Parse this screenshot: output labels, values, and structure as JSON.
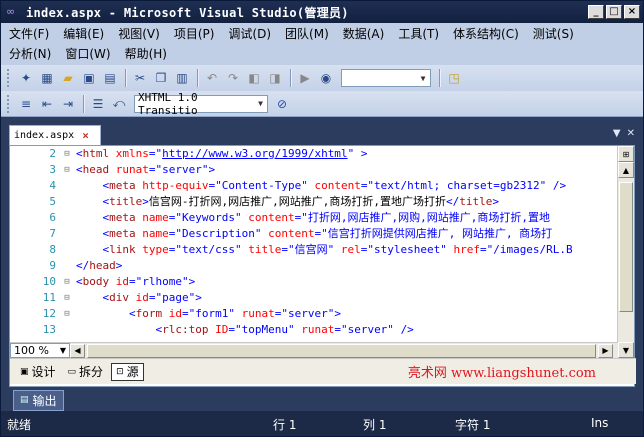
{
  "window": {
    "title": "index.aspx - Microsoft Visual Studio(管理员)",
    "min": "_",
    "max": "□",
    "close": "×"
  },
  "menu": {
    "row1": [
      "文件(F)",
      "编辑(E)",
      "视图(V)",
      "项目(P)",
      "调试(D)",
      "团队(M)",
      "数据(A)",
      "工具(T)",
      "体系结构(C)",
      "测试(S)"
    ],
    "row2": [
      "分析(N)",
      "窗口(W)",
      "帮助(H)"
    ]
  },
  "toolbar": {
    "solution_config": "",
    "doc_type": "XHTML 1.0 Transitio"
  },
  "tab": {
    "label": "index.aspx",
    "close": "×"
  },
  "code": [
    {
      "n": "2",
      "fold": "⊟",
      "html": "<span class='b'>&lt;</span><span class='t'>html</span> <span class='a'>xmlns</span><span class='b'>=\"<u>http://www.w3.org/1999/xhtml</u>\"</span> <span class='b'>&gt;</span>"
    },
    {
      "n": "3",
      "fold": "⊟",
      "html": "<span class='b'>&lt;</span><span class='t'>head</span> <span class='a'>runat</span><span class='b'>=\"server\"&gt;</span>"
    },
    {
      "n": "4",
      "fold": "",
      "html": "    <span class='b'>&lt;</span><span class='t'>meta</span> <span class='a'>http-equiv</span><span class='b'>=\"Content-Type\"</span> <span class='a'>content</span><span class='b'>=\"text/html; charset=gb2312\"</span> <span class='b'>/&gt;</span>"
    },
    {
      "n": "5",
      "fold": "",
      "html": "    <span class='b'>&lt;</span><span class='t'>title</span><span class='b'>&gt;</span>信宫网-打折网,网店推广,网站推广,商场打折,置地广场打折<span class='b'>&lt;/</span><span class='t'>title</span><span class='b'>&gt;</span>"
    },
    {
      "n": "6",
      "fold": "",
      "html": "    <span class='b'>&lt;</span><span class='t'>meta</span> <span class='a'>name</span><span class='b'>=\"Keywords\"</span> <span class='a'>content</span><span class='b'>=\"打折网,网店推广,网购,网站推广,商场打折,置地</span>"
    },
    {
      "n": "7",
      "fold": "",
      "html": "    <span class='b'>&lt;</span><span class='t'>meta</span> <span class='a'>name</span><span class='b'>=\"Description\"</span> <span class='a'>content</span><span class='b'>=\"信宫打折网提供网店推广, 网站推广, 商场打</span>"
    },
    {
      "n": "8",
      "fold": "",
      "html": "    <span class='b'>&lt;</span><span class='t'>link</span> <span class='a'>type</span><span class='b'>=\"text/css\"</span> <span class='a'>title</span><span class='b'>=\"信宫网\"</span> <span class='a'>rel</span><span class='b'>=\"stylesheet\"</span> <span class='a'>href</span><span class='b'>=\"/images/RL.B</span>"
    },
    {
      "n": "9",
      "fold": "",
      "html": "<span class='b'>&lt;/</span><span class='t'>head</span><span class='b'>&gt;</span>"
    },
    {
      "n": "10",
      "fold": "⊟",
      "html": "<span class='b'>&lt;</span><span class='t'>body</span> <span class='a'>id</span><span class='b'>=\"rlhome\"&gt;</span>"
    },
    {
      "n": "11",
      "fold": "⊟",
      "html": "    <span class='b'>&lt;</span><span class='t'>div</span> <span class='a'>id</span><span class='b'>=\"page\"&gt;</span>"
    },
    {
      "n": "12",
      "fold": "⊟",
      "html": "        <span class='b'>&lt;</span><span class='t'>form</span> <span class='a'>id</span><span class='b'>=\"form1\"</span> <span class='a'>runat</span><span class='b'>=\"server\"&gt;</span>"
    },
    {
      "n": "13",
      "fold": "",
      "html": "            <span class='b'>&lt;</span><span class='t'>rlc:top</span> <span class='a'>ID</span><span class='b'>=\"topMenu\"</span> <span class='a'>runat</span><span class='b'>=\"server\"</span> <span class='b'>/&gt;</span>"
    }
  ],
  "zoom": "100 %",
  "views": {
    "design": "设计",
    "split": "拆分",
    "source": "源"
  },
  "watermark": "亮术网 www.liangshunet.com",
  "output": "输出",
  "status": {
    "ready": "就绪",
    "line": "行 1",
    "col": "列 1",
    "char": "字符 1",
    "mode": "Ins"
  }
}
